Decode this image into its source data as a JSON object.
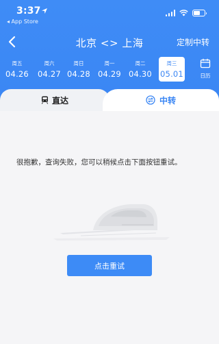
{
  "status_bar": {
    "time": "3:37",
    "back_app": "◂ App Store"
  },
  "nav": {
    "route_title": "北京 <> 上海",
    "custom_transfer": "定制中转"
  },
  "dates": [
    {
      "weekday": "周五",
      "date": "04.26",
      "active": false
    },
    {
      "weekday": "周六",
      "date": "04.27",
      "active": false
    },
    {
      "weekday": "周日",
      "date": "04.28",
      "active": false
    },
    {
      "weekday": "周一",
      "date": "04.29",
      "active": false
    },
    {
      "weekday": "周二",
      "date": "04.30",
      "active": false
    },
    {
      "weekday": "周三",
      "date": "05.01",
      "active": true
    }
  ],
  "calendar_label": "日历",
  "tabs": {
    "direct": "直达",
    "transfer": "中转"
  },
  "error_message": "很抱歉，查询失败，您可以稍候点击下面按钮重试。",
  "retry_button": "点击重试",
  "colors": {
    "brand_blue": "#3a86f4",
    "background": "#f5f5f7"
  }
}
